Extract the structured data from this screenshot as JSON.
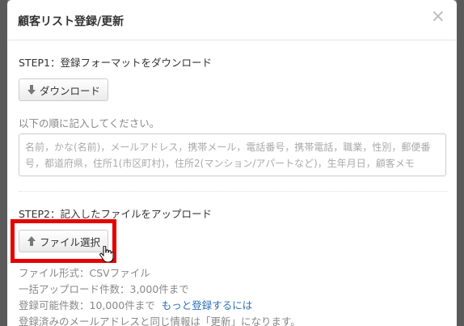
{
  "dialog": {
    "title": "顧客リスト登録/更新",
    "close_label": "×"
  },
  "step1": {
    "title": "STEP1：登録フォーマットをダウンロード",
    "download_label": "ダウンロード",
    "download_icon": "arrow-down-icon",
    "instruction": "以下の順に記入してください。",
    "format_fields": "名前，かな(名前)，メールアドレス，携帯メール，電話番号，携帯電話，職業，性別，郵便番号，都道府県，住所1(市区町村)，住所2(マンション/アパートなど)，生年月日，顧客メモ"
  },
  "step2": {
    "title": "STEP2：記入したファイルをアップロード",
    "select_file_label": "ファイル選択",
    "select_file_icon": "arrow-up-icon",
    "file_format": "ファイル形式：CSVファイル",
    "bulk_limit": "一括アップロード件数：3,000件まで",
    "max_count": "登録可能件数：10,000件まで",
    "more_link": "もっと登録するには",
    "update_note": "登録済みのメールアドレスと同じ情報は「更新」になります。"
  },
  "colors": {
    "highlight": "#e60000",
    "link": "#2a6fba"
  }
}
